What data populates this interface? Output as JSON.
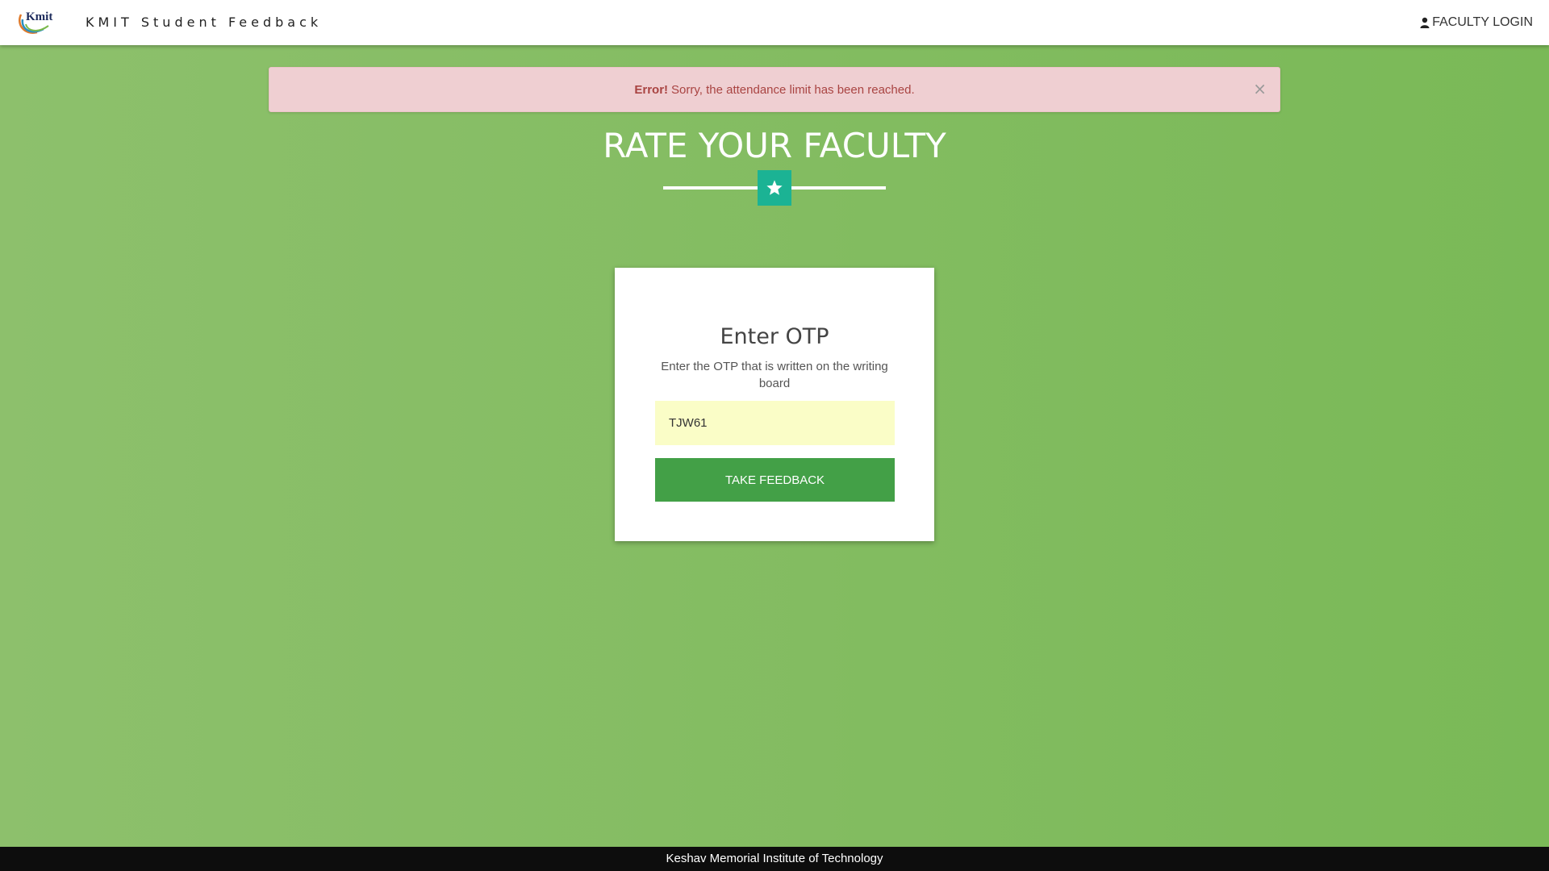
{
  "navbar": {
    "logo_text": "Kmit",
    "brand": "KMIT Student Feedback",
    "faculty_login": "FACULTY LOGIN"
  },
  "alert": {
    "label": "Error!",
    "message": "Sorry, the attendance limit has been reached.",
    "close": "×"
  },
  "hero": {
    "heading": "RATE YOUR FACULTY"
  },
  "otp_card": {
    "title": "Enter OTP",
    "description": "Enter the OTP that is written on the writing board",
    "input_value": "TJW61",
    "button_label": "TAKE FEEDBACK"
  },
  "footer": {
    "text": "Keshav Memorial Institute of Technology"
  },
  "colors": {
    "background": "#86bd63",
    "accent_teal": "#1bb394",
    "button_green": "#43a047",
    "alert_text": "#a94442"
  }
}
